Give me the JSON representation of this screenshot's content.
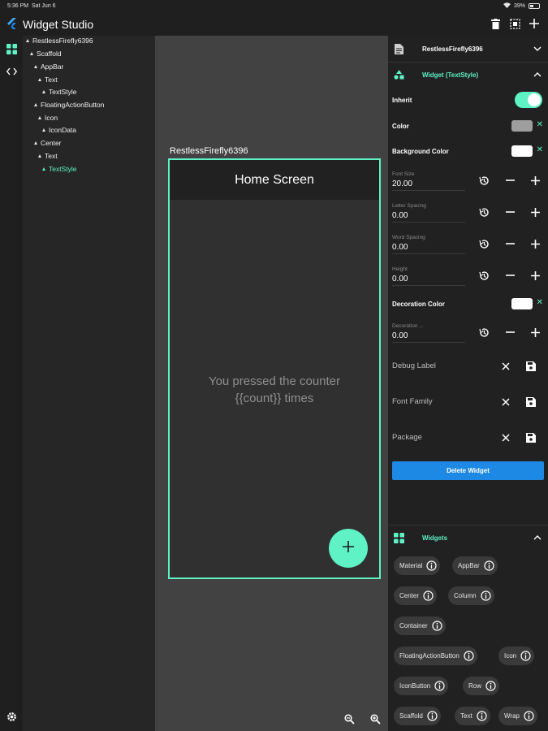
{
  "status_bar": {
    "time": "5:36 PM",
    "date": "Sat Jun 6",
    "battery": "39%"
  },
  "app": {
    "title": "Widget Studio"
  },
  "tree": {
    "nodes": [
      {
        "label": "RestlessFirefly6396"
      },
      {
        "label": "Scaffold"
      },
      {
        "label": "AppBar"
      },
      {
        "label": "Text"
      },
      {
        "label": "TextStyle"
      },
      {
        "label": "FloatingActionButton"
      },
      {
        "label": "Icon"
      },
      {
        "label": "IconData"
      },
      {
        "label": "Center"
      },
      {
        "label": "Text"
      },
      {
        "label": "TextStyle"
      }
    ]
  },
  "canvas": {
    "caption": "RestlessFirefly6396",
    "appbar_title": "Home Screen",
    "message_line1": "You pressed the counter",
    "message_line2": "{{count}} times"
  },
  "props": {
    "file_name": "RestlessFirefly6396",
    "widget_header": "Widget (TextStyle)",
    "inherit_label": "Inherit",
    "inherit_value": true,
    "color_label": "Color",
    "bg_color_label": "Background Color",
    "font_size_caption": "Font Size",
    "font_size_value": "20.00",
    "letter_spacing_caption": "Letter Spacing",
    "letter_spacing_value": "0.00",
    "word_spacing_caption": "Word Spacing",
    "word_spacing_value": "0.00",
    "height_caption": "Height",
    "height_value": "0.00",
    "decoration_color_label": "Decoration Color",
    "decoration_caption": "Decoration ...",
    "decoration_value": "0.00",
    "debug_label": "Debug Label",
    "font_family_label": "Font Family",
    "package_label": "Package",
    "delete_label": "Delete Widget"
  },
  "widgets": {
    "header": "Widgets",
    "chips": [
      "Material",
      "AppBar",
      "Center",
      "Column",
      "Container",
      "FloatingActionButton",
      "Icon",
      "IconButton",
      "Row",
      "Scaffold",
      "Text",
      "Wrap"
    ]
  },
  "colors": {
    "accent": "#5ef2c4",
    "primary_button": "#1e88e5",
    "color_swatch": "#9e9e9e",
    "background_swatch": "#ffffff",
    "decoration_swatch": "#ffffff"
  }
}
